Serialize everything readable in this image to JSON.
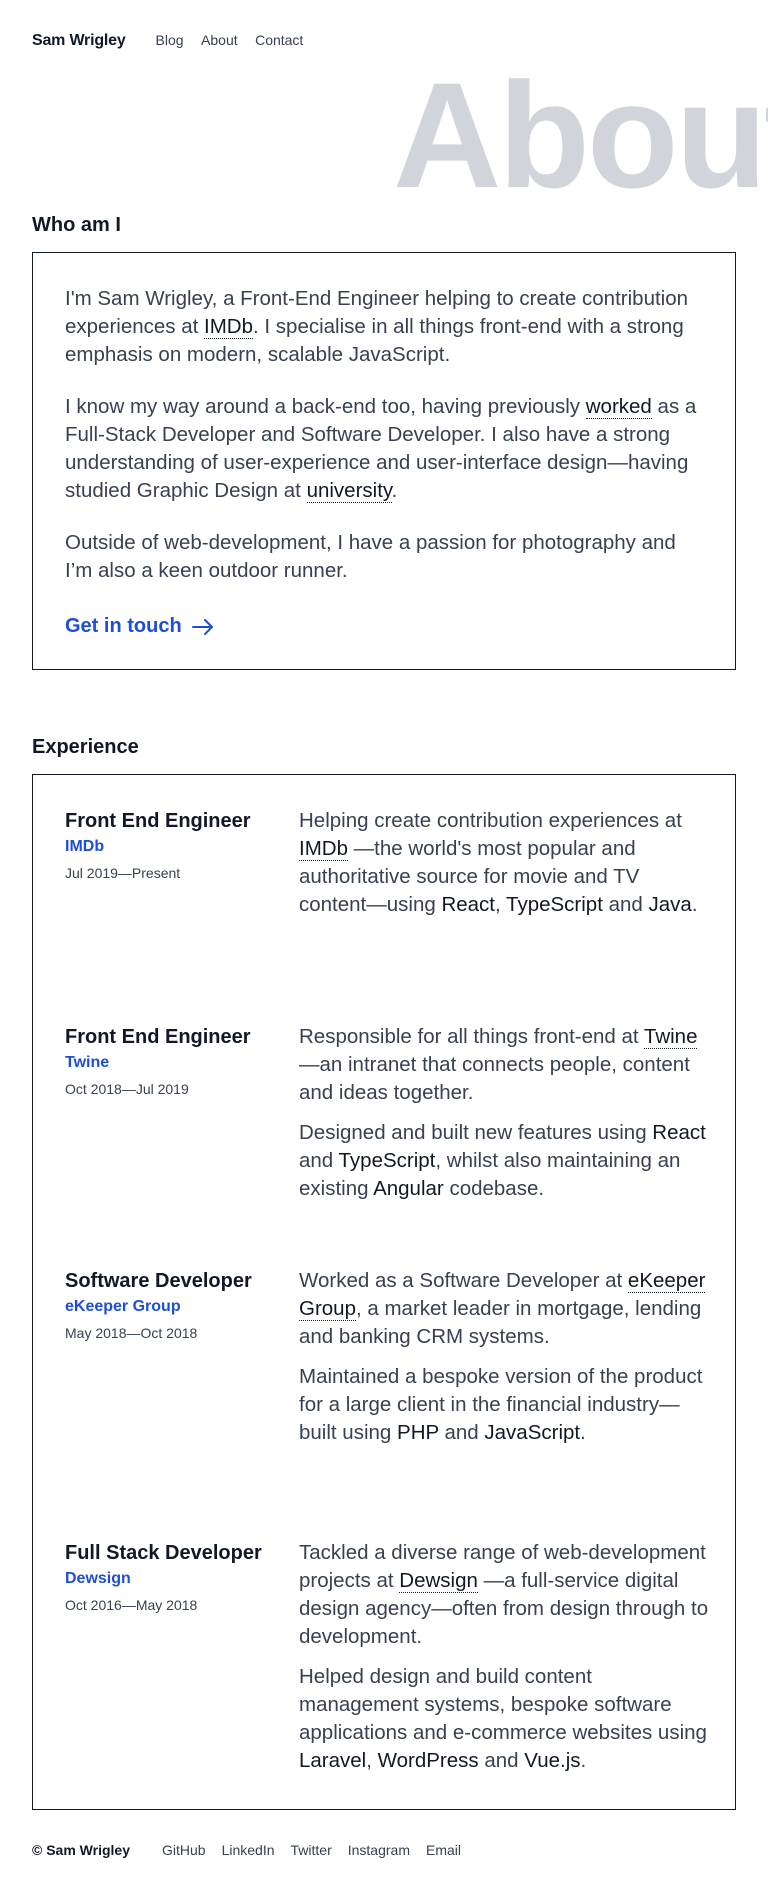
{
  "header": {
    "brand": "Sam Wrigley",
    "nav": [
      "Blog",
      "About",
      "Contact"
    ]
  },
  "hero": {
    "word": "About"
  },
  "about": {
    "title": "Who am I",
    "p1_a": "I'm Sam Wrigley, a Front-End Engineer helping to create contribution experiences at ",
    "p1_link": "IMDb",
    "p1_b": ". I specialise in all things front-end with a strong emphasis on modern, scalable JavaScript.",
    "p2_a": "I know my way around a back-end too, having previously ",
    "p2_link1": "worked",
    "p2_b": " as a Full-Stack Developer and Software Developer. I also have a strong understanding of user-experience and user-interface design—having studied Graphic Design at ",
    "p2_link2": "university",
    "p2_c": ".",
    "p3": "Outside of web-development, I have a passion for photography and I’m also a keen outdoor runner.",
    "cta": "Get in touch"
  },
  "experience": {
    "title": "Experience",
    "jobs": [
      {
        "title": "Front End Engineer",
        "company": "IMDb",
        "dates": "Jul 2019—Present",
        "p1_a": "Helping create contribution experiences at ",
        "p1_link": "IMDb",
        "p1_b": " —the world's most popular and authoritative source for movie and TV content—using ",
        "t1": "React",
        "sep1": ", ",
        "t2": "TypeScript",
        "sep2": " and ",
        "t3": "Java",
        "end": "."
      },
      {
        "title": "Front End Engineer",
        "company": "Twine",
        "dates": "Oct 2018—Jul 2019",
        "p1_a": "Responsible for all things front-end at ",
        "p1_link": "Twine",
        "p1_b": " —an intranet that connects people, content and ideas together.",
        "p2_a": "Designed and built new features using ",
        "t1": "React",
        "sep1": " and ",
        "t2": "TypeScript",
        "sep2": ", whilst also maintaining an existing ",
        "t3": "Angular",
        "end": " codebase."
      },
      {
        "title": "Software Developer",
        "company": "eKeeper Group",
        "dates": "May 2018—Oct 2018",
        "p1_a": "Worked as a Software Developer at ",
        "p1_link": "eKeeper Group",
        "p1_b": ", a market leader in mortgage, lending and banking CRM systems.",
        "p2_a": "Maintained a bespoke version of the product for a large client in the financial industry—built using ",
        "t1": "PHP",
        "sep1": " and ",
        "t2": "JavaScript",
        "end": "."
      },
      {
        "title": "Full Stack Developer",
        "company": "Dewsign",
        "dates": "Oct 2016—May 2018",
        "p1_a": "Tackled a diverse range of web-development projects at ",
        "p1_link": "Dewsign",
        "p1_b": " —a full-service digital design agency—often from design through to development.",
        "p2_a": "Helped design and build content management systems, bespoke software applications and e-commerce websites using ",
        "t1": "Laravel",
        "sep1": ", ",
        "t2": "WordPress",
        "sep2": " and ",
        "t3": "Vue.js",
        "end": "."
      }
    ]
  },
  "footer": {
    "copy": "© Sam Wrigley",
    "links": [
      "GitHub",
      "LinkedIn",
      "Twitter",
      "Instagram",
      "Email"
    ]
  }
}
